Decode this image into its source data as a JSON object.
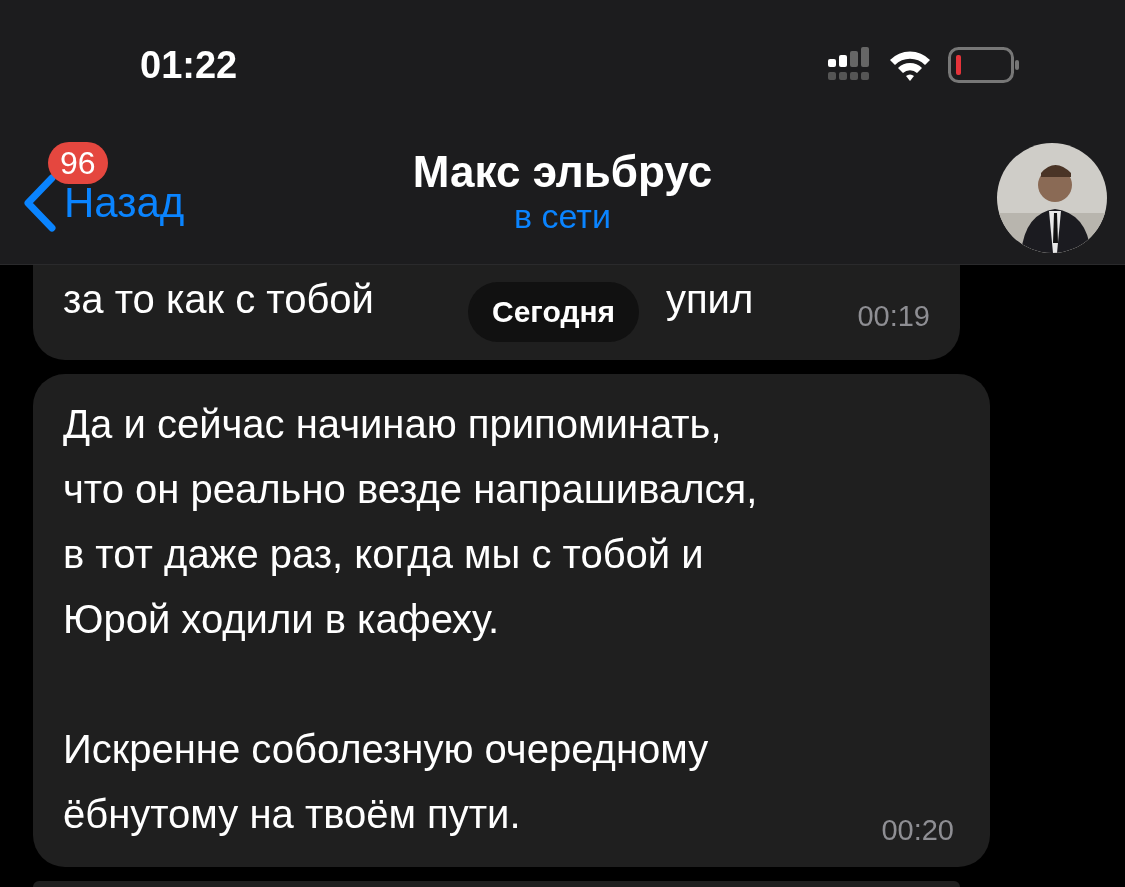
{
  "status_bar": {
    "time": "01:22"
  },
  "header": {
    "back_label": "Назад",
    "unread_badge": "96",
    "title": "Макс эльбрус",
    "subtitle": "в сети"
  },
  "date_pill": "Сегодня",
  "messages": [
    {
      "kind": "partial",
      "text_before": "за то как с тобой",
      "text_after": "упил",
      "time": "00:19"
    },
    {
      "kind": "full",
      "paragraphs": [
        [
          "Да и сейчас начинаю припоминать,",
          "что он реально везде напрашивался,",
          "в тот даже раз, когда мы с тобой и",
          "Юрой ходили в кафеху."
        ],
        [
          "Искренне соболезную очередному",
          "ёбнутому на твоём пути."
        ]
      ],
      "time": "00:20"
    },
    {
      "kind": "stub"
    }
  ]
}
